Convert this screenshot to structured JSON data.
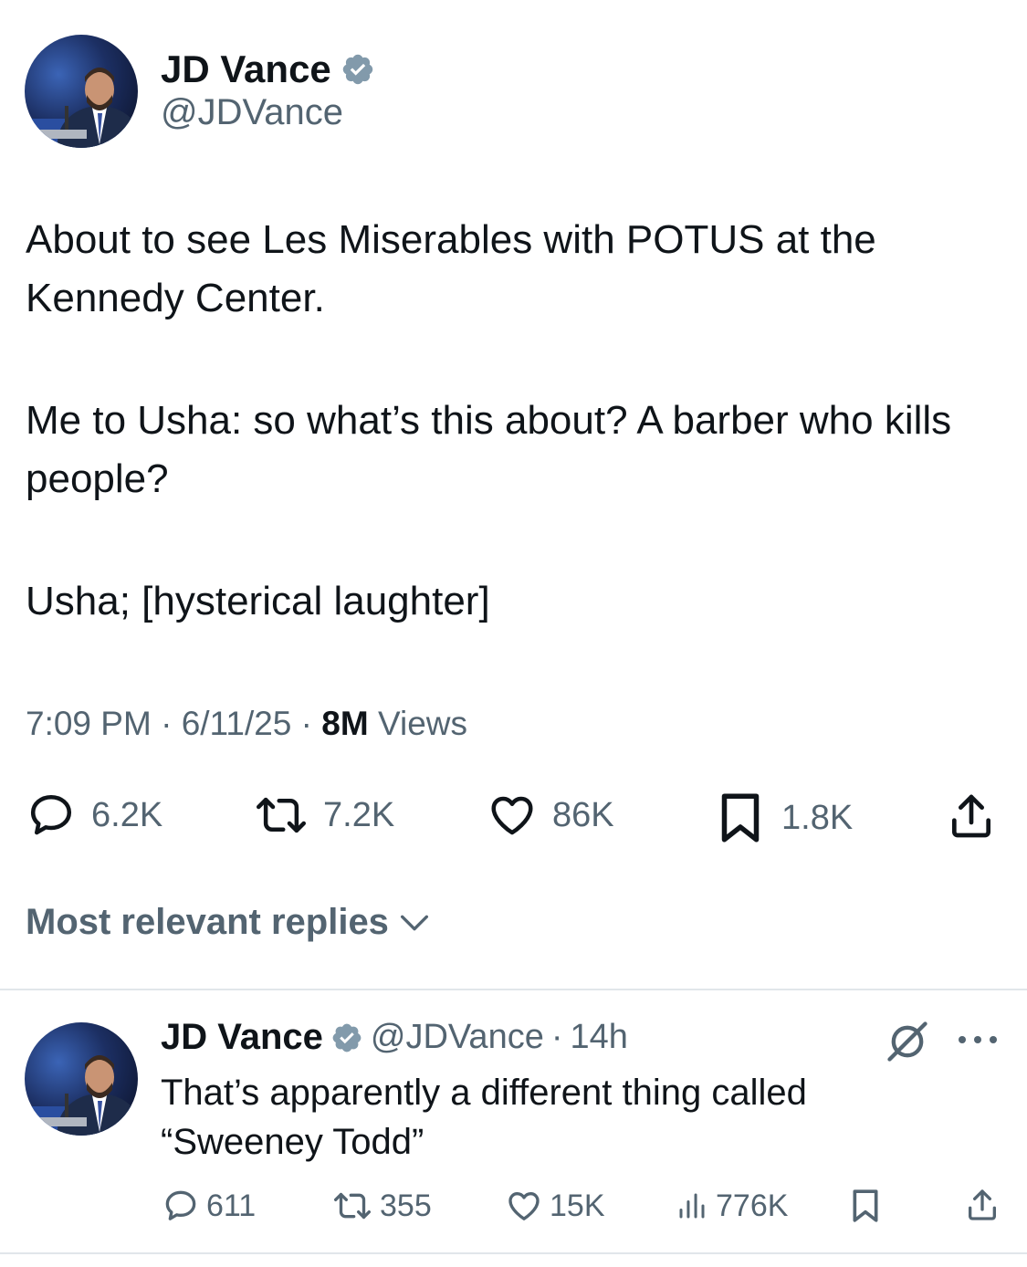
{
  "tweet": {
    "author_name": "JD Vance",
    "author_handle": "@JDVance",
    "paragraphs": [
      "About to see Les Miserables with POTUS at the Kennedy Center.",
      "Me to Usha: so what’s this about? A barber who kills people?",
      "Usha; [hysterical laughter]"
    ],
    "time": "7:09 PM",
    "date": "6/11/25",
    "views_count": "8M",
    "views_label": "Views",
    "dot": "·",
    "stats": {
      "replies": "6.2K",
      "reposts": "7.2K",
      "likes": "86K",
      "bookmarks": "1.8K"
    }
  },
  "replies_sort": {
    "label": "Most relevant replies"
  },
  "reply": {
    "author_name": "JD Vance",
    "author_handle": "@JDVance",
    "age": "14h",
    "dot": "·",
    "text": "That’s apparently a different thing called “Sweeney Todd”",
    "stats": {
      "replies": "611",
      "reposts": "355",
      "likes": "15K",
      "views": "776K"
    }
  },
  "colors": {
    "text": "#0f1419",
    "secondary": "#536471",
    "verified": "#829aab",
    "divider": "#e1e6ea"
  },
  "icons": [
    "verified-badge-icon",
    "reply-icon",
    "repost-icon",
    "like-icon",
    "bookmark-icon",
    "share-icon",
    "chevron-down-icon",
    "grok-icon",
    "more-icon",
    "views-icon"
  ]
}
